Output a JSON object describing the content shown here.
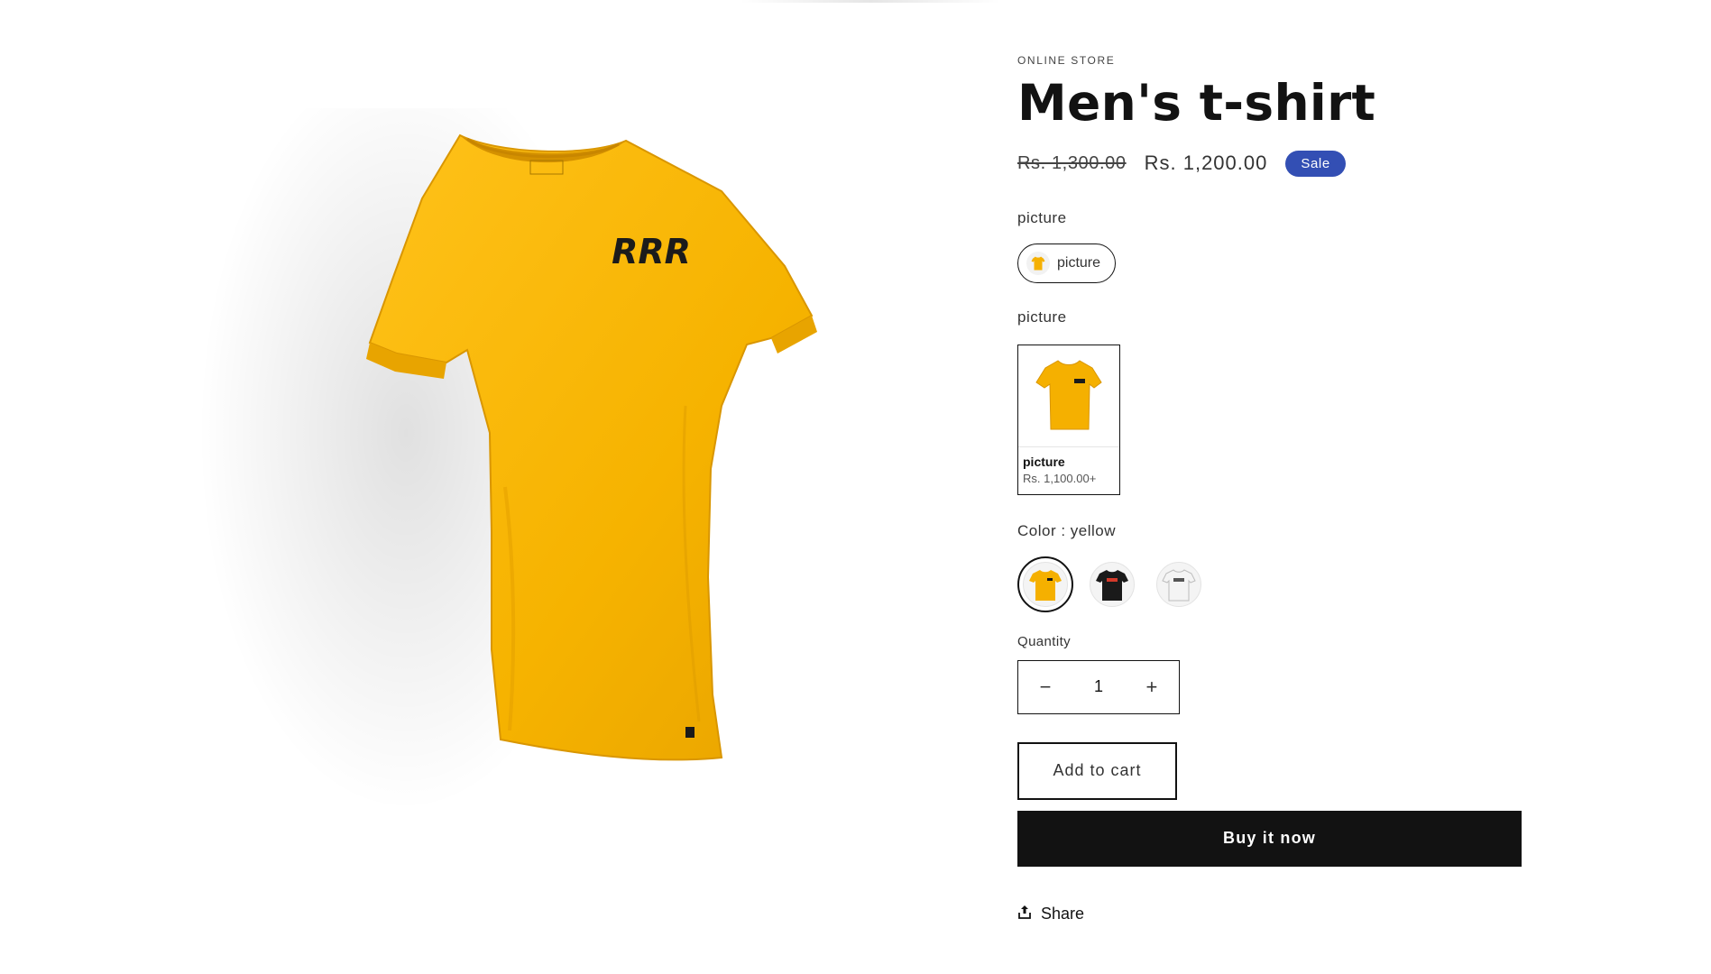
{
  "product": {
    "vendor": "ONLINE STORE",
    "title": "Men's t-shirt",
    "price_regular": "Rs. 1,300.00",
    "price_sale": "Rs. 1,200.00",
    "sale_badge": "Sale",
    "image_print": "RRR"
  },
  "option_picture_1": {
    "label": "picture",
    "pill_label": "picture"
  },
  "option_picture_2": {
    "label": "picture",
    "card_title": "picture",
    "card_price": "Rs. 1,100.00+"
  },
  "color_option": {
    "label": "Color : yellow",
    "swatches": [
      {
        "name": "yellow",
        "color": "#f5b000",
        "selected": true
      },
      {
        "name": "black",
        "color": "#1a1a1a",
        "selected": false
      },
      {
        "name": "white",
        "color": "#f0f0f0",
        "selected": false
      }
    ]
  },
  "quantity": {
    "label": "Quantity",
    "value": "1",
    "minus_icon": "minus-icon",
    "plus_icon": "plus-icon"
  },
  "actions": {
    "add_to_cart": "Add to cart",
    "buy_now": "Buy it now",
    "share": "Share",
    "share_icon": "share-icon"
  },
  "colors": {
    "accent_badge": "#334fb4",
    "shirt_yellow": "#f5b000",
    "button_dark": "#121212"
  }
}
